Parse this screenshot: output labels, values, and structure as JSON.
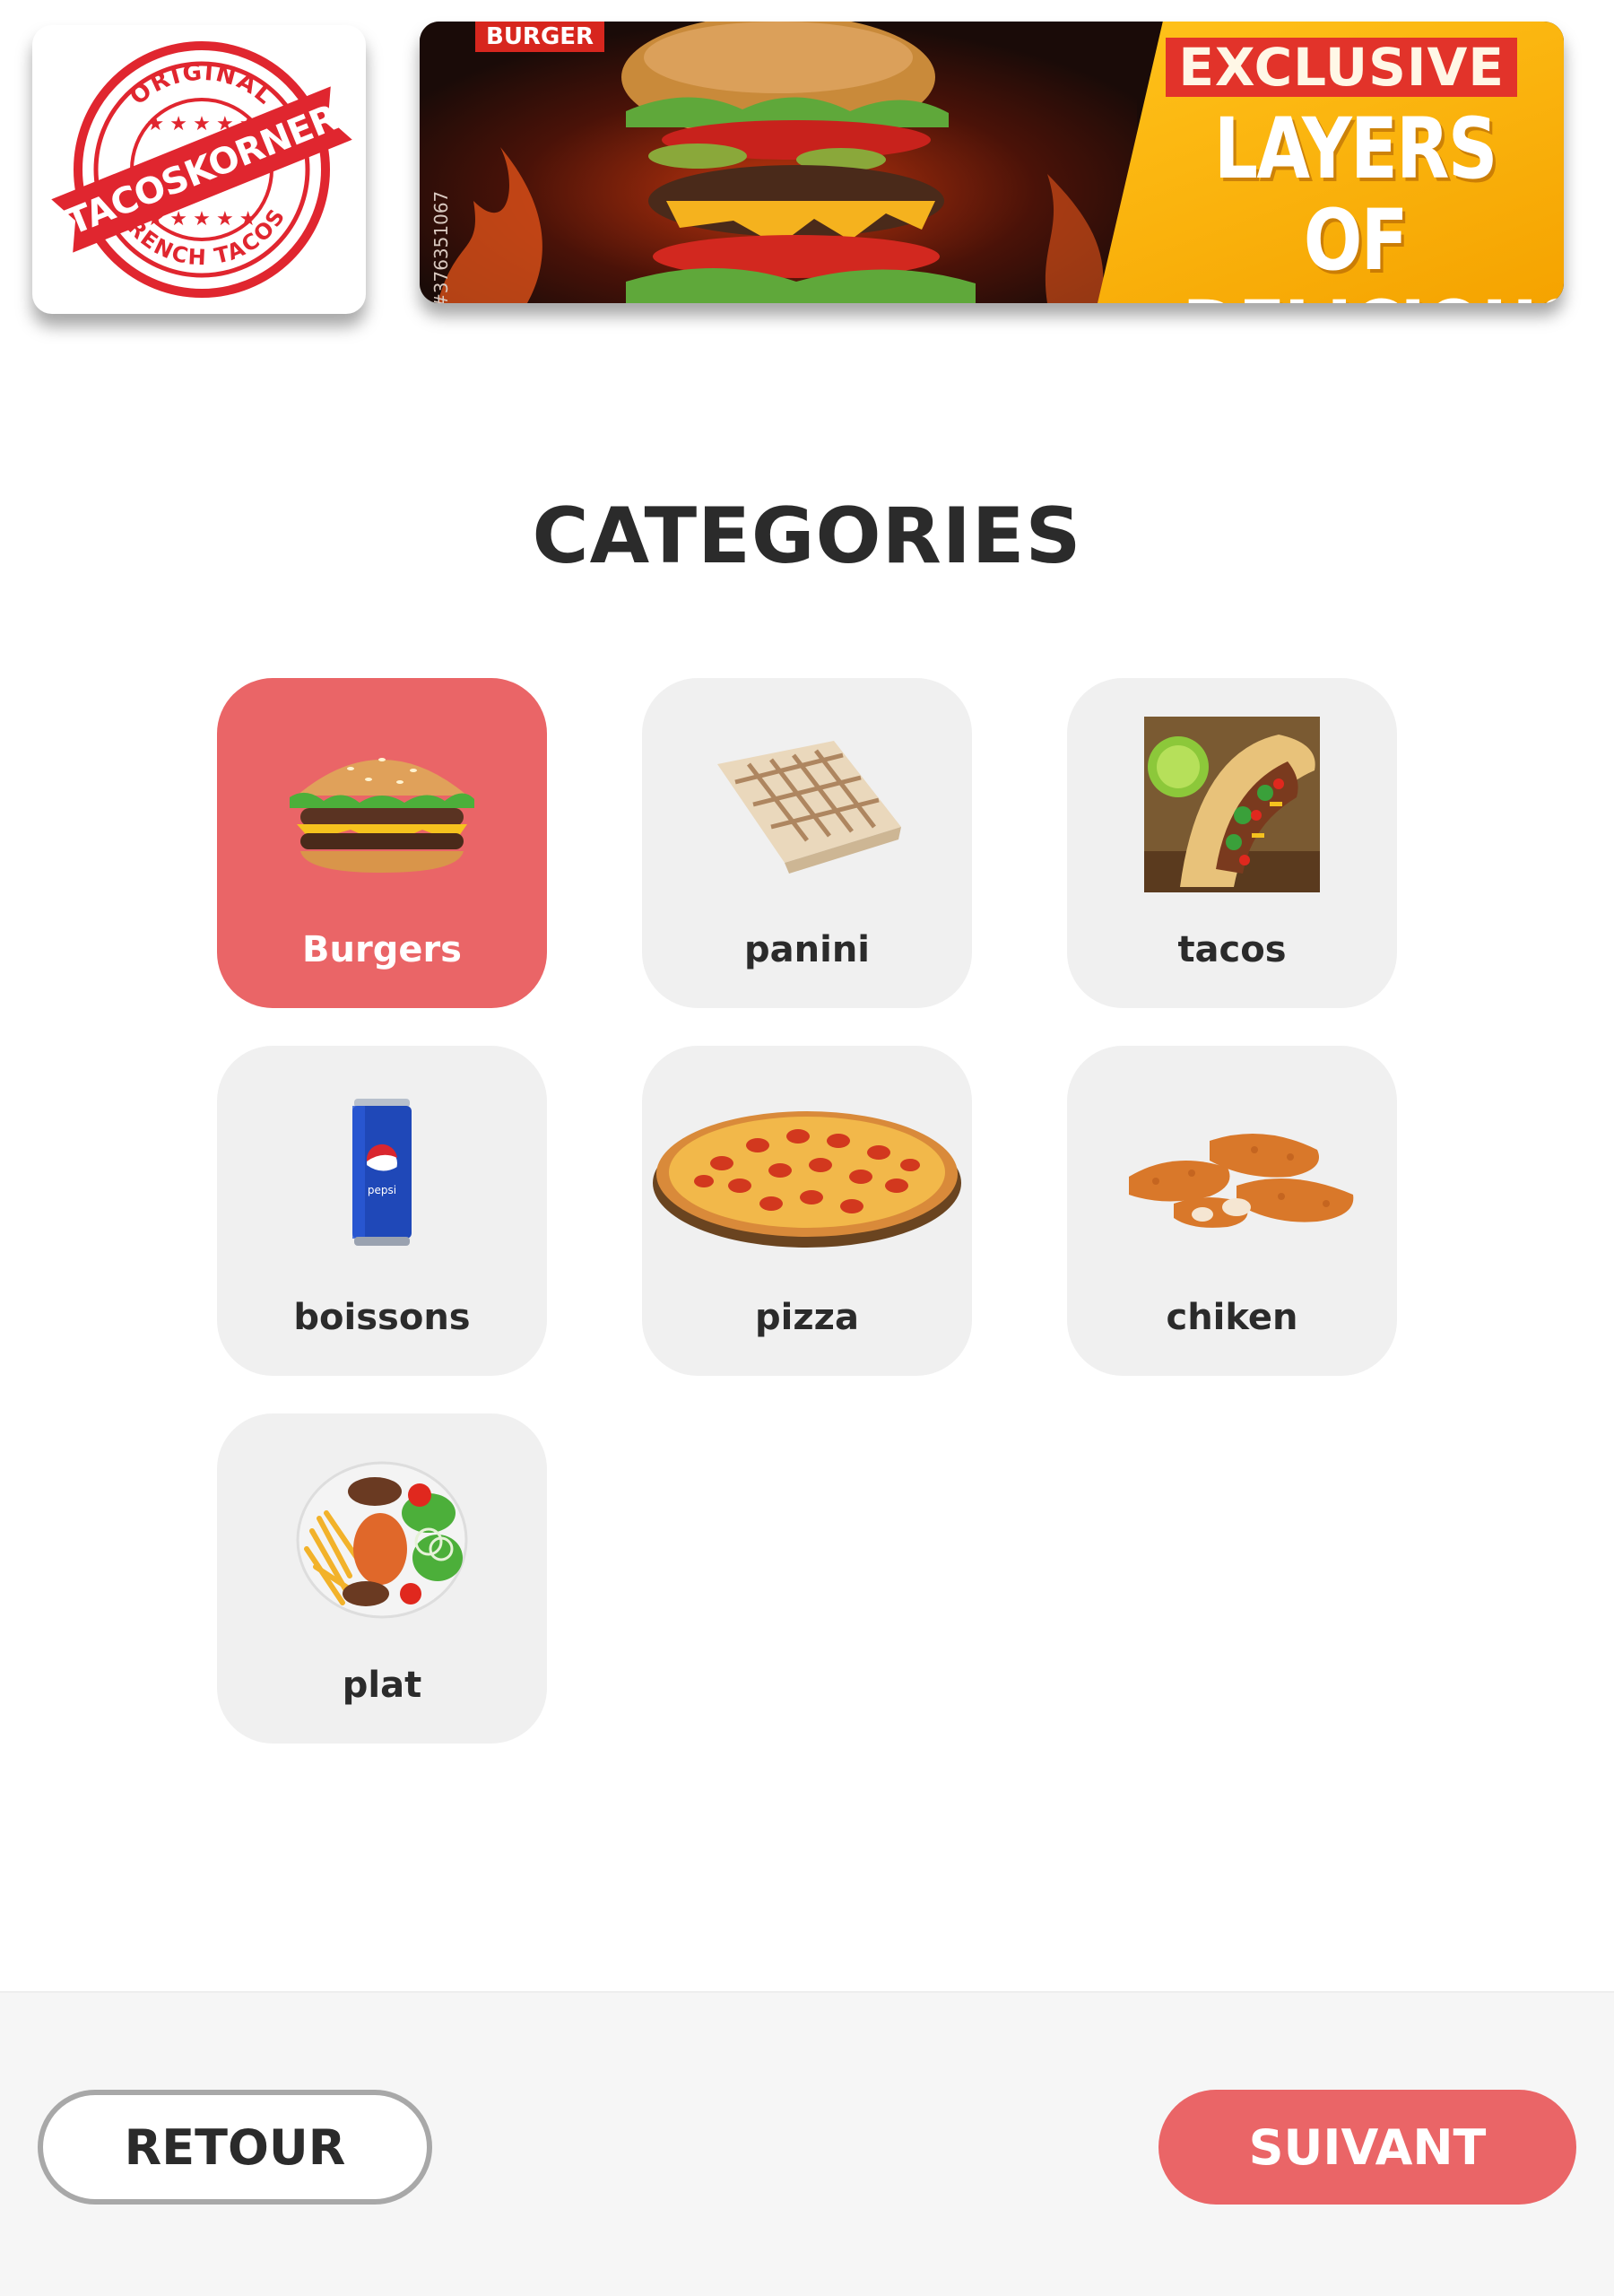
{
  "header": {
    "logo": {
      "arc_top": "ORIGINAL",
      "ribbon": "TACOSKORNER",
      "arc_bottom": "FRENCH TACOS",
      "color": "#e0262f"
    },
    "banner": {
      "tag": "BURGER",
      "exclusive": "EXCLUSIVE",
      "headline_line1": "LAYERS OF",
      "headline_line2": "DELICIOUS",
      "stock_id": "#376351067"
    }
  },
  "page_title": "CATEGORIES",
  "categories": [
    {
      "label": "Burgers",
      "icon": "burger-image",
      "selected": true
    },
    {
      "label": "panini",
      "icon": "panini-image",
      "selected": false
    },
    {
      "label": "tacos",
      "icon": "tacos-image",
      "selected": false
    },
    {
      "label": "boissons",
      "icon": "soda-can-image",
      "selected": false
    },
    {
      "label": "pizza",
      "icon": "pizza-image",
      "selected": false
    },
    {
      "label": "chiken",
      "icon": "chicken-tenders-image",
      "selected": false
    },
    {
      "label": "plat",
      "icon": "plate-image",
      "selected": false
    }
  ],
  "footer": {
    "back_label": "RETOUR",
    "next_label": "SUIVANT"
  },
  "colors": {
    "accent": "#ea6567",
    "tile_bg": "#f0f0f0",
    "text": "#2b2b2b"
  }
}
